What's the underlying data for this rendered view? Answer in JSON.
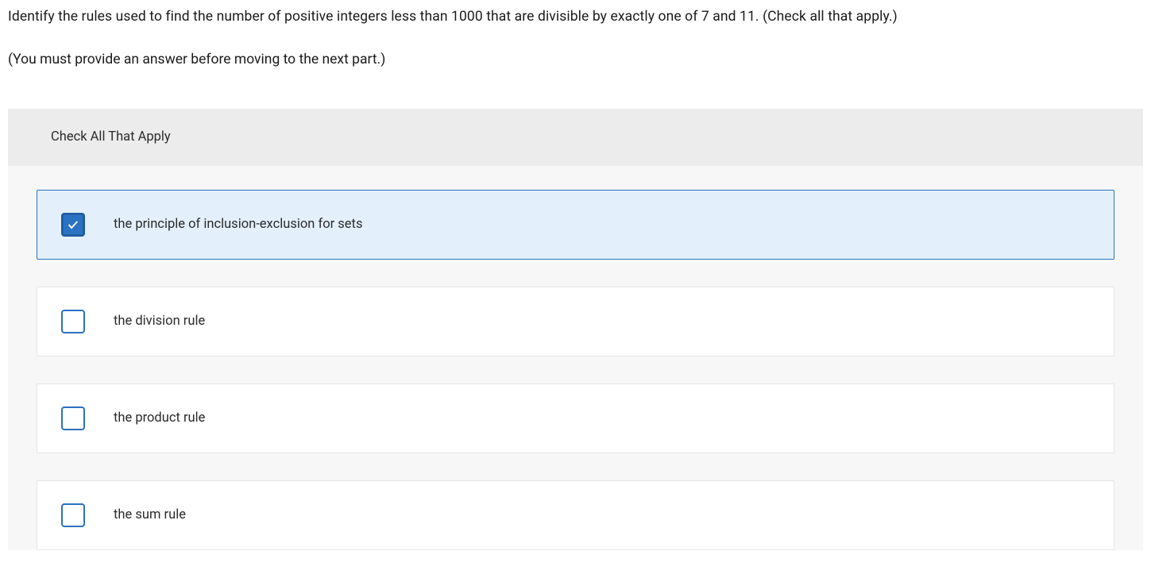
{
  "question": "Identify the rules used to find the number of positive integers less than 1000 that are divisible by exactly one of 7 and 11. (Check all that apply.)",
  "instruction": "(You must provide an answer before moving to the next part.)",
  "header": "Check All That Apply",
  "options": [
    {
      "label": "the principle of inclusion-exclusion for sets",
      "checked": true
    },
    {
      "label": "the division rule",
      "checked": false
    },
    {
      "label": "the product rule",
      "checked": false
    },
    {
      "label": "the sum rule",
      "checked": false
    }
  ]
}
